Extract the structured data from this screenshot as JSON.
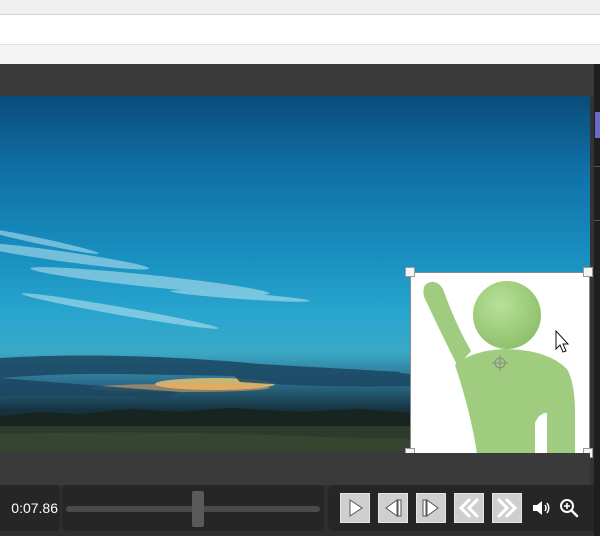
{
  "player": {
    "time_display": "0:07.86",
    "seek_progress": 0.52
  },
  "controls": {
    "play": "play-icon",
    "step_back": "step-back-icon",
    "step_forward": "step-forward-icon",
    "rewind": "rewind-icon",
    "fast_forward": "fast-forward-icon",
    "volume": "volume-icon",
    "zoom": "zoom-in-icon"
  },
  "colors": {
    "accent": "#6a6ac8",
    "pip_figure": "#9fcc7e"
  }
}
